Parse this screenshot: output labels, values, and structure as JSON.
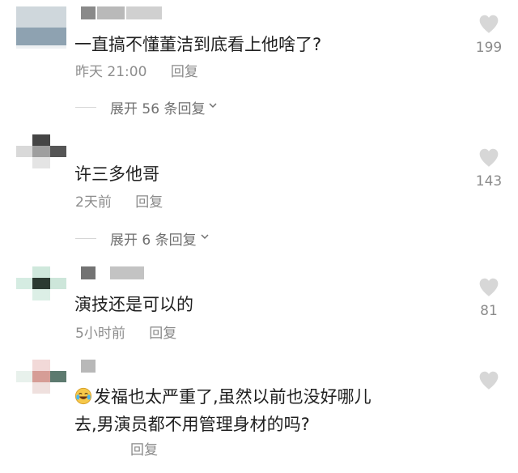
{
  "colors": {
    "text_primary": "#202020",
    "text_secondary": "#8d8d8d",
    "expand_text": "#707070",
    "like_icon": "#d7d7d7"
  },
  "comments": [
    {
      "text": "一直搞不懂董洁到底看上他啥了?",
      "time": "昨天 21:00",
      "reply": "回复",
      "expand": "展开 56 条回复",
      "likes": "199",
      "avatar_icon": "avatar-mosaic"
    },
    {
      "text": "许三多他哥",
      "time": "2天前",
      "reply": "回复",
      "expand": "展开 6 条回复",
      "likes": "143",
      "avatar_icon": "avatar-mosaic"
    },
    {
      "text": "演技还是可以的",
      "time": "5小时前",
      "reply": "回复",
      "likes": "81",
      "avatar_icon": "avatar-mosaic"
    },
    {
      "emoji": "laughing-crying-emoji",
      "text_line1": "发福也太严重了,虽然以前也没好哪儿",
      "text_line2": "去,男演员都不用管理身材的吗?",
      "reply": "回复",
      "avatar_icon": "avatar-mosaic"
    }
  ]
}
